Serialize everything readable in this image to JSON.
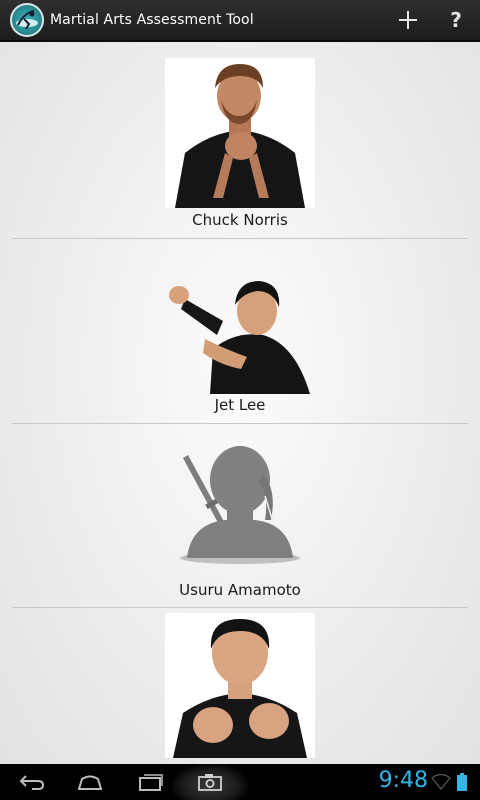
{
  "action_bar": {
    "title": "Martial Arts Assessment Tool",
    "add_icon": "plus-icon",
    "help_label": "?"
  },
  "list": {
    "items": [
      {
        "name": "Chuck Norris",
        "photo": "person-photo-dark-gi-hands-clasped"
      },
      {
        "name": "Jet Lee",
        "photo": "person-photo-martial-arts-pose"
      },
      {
        "name": "Usuru Amamoto",
        "photo": "placeholder-ninja-silhouette"
      },
      {
        "name": "",
        "photo": "person-photo-fists-raised"
      }
    ]
  },
  "system_bar": {
    "time": "9:48",
    "accent_color": "#33b5e5",
    "icons": [
      "back-icon",
      "home-icon",
      "recent-apps-icon",
      "camera-icon",
      "wifi-icon",
      "battery-icon"
    ]
  }
}
